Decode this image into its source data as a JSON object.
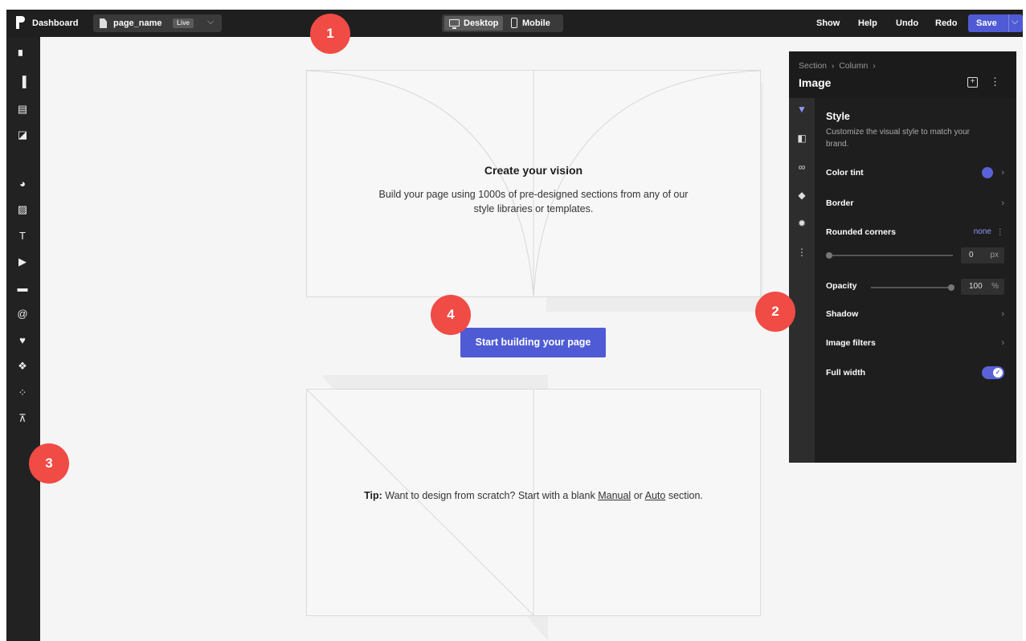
{
  "topbar": {
    "dashboard_label": "Dashboard",
    "page_name": "page_name",
    "live_badge": "Live",
    "devices": {
      "desktop": "Desktop",
      "mobile": "Mobile"
    },
    "actions": {
      "show": "Show",
      "help": "Help",
      "undo": "Undo",
      "redo": "Redo",
      "save": "Save"
    }
  },
  "left_toolbar": {
    "tools": [
      "pages-icon",
      "page-icon",
      "sections-icon",
      "saved-sections-icon",
      "shapes-icon",
      "image-icon",
      "text-icon",
      "video-icon",
      "form-icon",
      "email-icon",
      "heart-icon",
      "components-icon",
      "apps-icon",
      "cart-icon"
    ]
  },
  "canvas": {
    "hero_title": "Create your vision",
    "hero_description": "Build your page using 1000s of pre-designed sections from any of our style libraries or templates.",
    "cta_label": "Start building your page",
    "tip": {
      "prefix": "Tip:",
      "text": "Want to design from scratch? Start with a blank",
      "manual_link": "Manual",
      "or": "or",
      "auto_link": "Auto",
      "suffix": "section."
    }
  },
  "markers": [
    "1",
    "2",
    "3",
    "4"
  ],
  "panel": {
    "breadcrumb": [
      "Section",
      "Column"
    ],
    "title": "Image",
    "section_title": "Style",
    "section_desc": "Customize the visual style to match your brand.",
    "rows": {
      "color_tint": "Color tint",
      "border": "Border",
      "rounded_corners": "Rounded corners",
      "rounded_value": "none",
      "corner_px_value": "0",
      "px_unit": "px",
      "opacity": "Opacity",
      "opacity_value": "100",
      "percent_unit": "%",
      "shadow": "Shadow",
      "image_filters": "Image filters",
      "full_width": "Full width"
    },
    "full_width_enabled": true,
    "tint_color": "#5b62d8"
  },
  "colors": {
    "accent": "#4f5bd5",
    "marker": "#f04b45",
    "topbar": "#1f1f1f"
  }
}
